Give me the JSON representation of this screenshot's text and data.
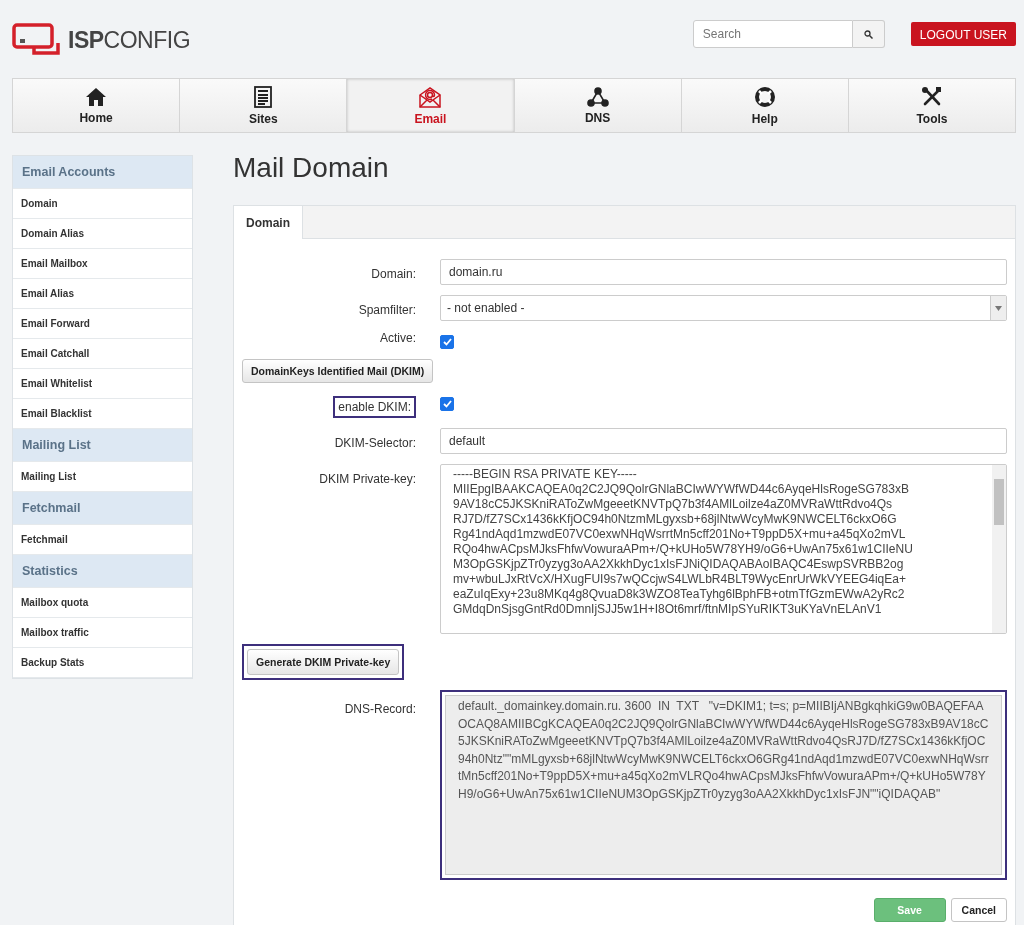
{
  "header": {
    "logo": "**ISP**CONFIG",
    "search": {
      "placeholder": "Search"
    },
    "logout": "LOGOUT USER"
  },
  "nav": [
    {
      "label": "Home",
      "selected": false
    },
    {
      "label": "Sites",
      "selected": false
    },
    {
      "label": "Email",
      "selected": true
    },
    {
      "label": "DNS",
      "selected": false
    },
    {
      "label": "Help",
      "selected": false
    },
    {
      "label": "Tools",
      "selected": false
    }
  ],
  "sidebar": [
    {
      "kind": "header",
      "label": "Email Accounts"
    },
    {
      "kind": "item",
      "label": "Domain"
    },
    {
      "kind": "item",
      "label": "Domain Alias"
    },
    {
      "kind": "item",
      "label": "Email Mailbox"
    },
    {
      "kind": "item",
      "label": "Email Alias"
    },
    {
      "kind": "item",
      "label": "Email Forward"
    },
    {
      "kind": "item",
      "label": "Email Catchall"
    },
    {
      "kind": "item",
      "label": "Email Whitelist"
    },
    {
      "kind": "item",
      "label": "Email Blacklist"
    },
    {
      "kind": "header",
      "label": "Mailing List"
    },
    {
      "kind": "item",
      "label": "Mailing List"
    },
    {
      "kind": "header",
      "label": "Fetchmail"
    },
    {
      "kind": "item",
      "label": "Fetchmail"
    },
    {
      "kind": "header",
      "label": "Statistics"
    },
    {
      "kind": "item",
      "label": "Mailbox quota"
    },
    {
      "kind": "item",
      "label": "Mailbox traffic"
    },
    {
      "kind": "item",
      "label": "Backup Stats"
    }
  ],
  "page_title": "Mail Domain",
  "tabs": [
    {
      "label": "Domain",
      "selected": true
    }
  ],
  "fields": [
    {
      "kind": "text",
      "label": "Domain:",
      "value": "domain.ru",
      "highlighted": false
    },
    {
      "kind": "select",
      "label": "Spamfilter:",
      "value": "- not enabled -",
      "highlighted": false
    },
    {
      "kind": "checkbox",
      "label": "Active:",
      "checked": true,
      "highlighted": false
    },
    {
      "kind": "button",
      "label": "DomainKeys Identified Mail (DKIM)",
      "highlighted": false
    },
    {
      "kind": "checkbox",
      "label": "enable DKIM:",
      "checked": true,
      "highlighted": true
    },
    {
      "kind": "text",
      "label": "DKIM-Selector:",
      "value": "default",
      "highlighted": false
    },
    {
      "kind": "textarea",
      "label": "DKIM Private-key:",
      "value": "-----BEGIN RSA PRIVATE KEY-----\nMIIEpgIBAAKCAQEA0q2C2JQ9QolrGNlaBCIwWYWfWD44c6AyqeHlsRogeSG783xB\n9AV18cC5JKSKniRAToZwMgeeetKNVTpQ7b3f4AMlLoilze4aZ0MVRaWttRdvo4Qs\nRJ7D/fZ7SCx1436kKfjOC94h0NtzmMLgyxsb+68jlNtwWcyMwK9NWCELT6ckxO6G\nRg41ndAqd1mzwdE07VC0exwNHqWsrrtMn5cff201No+T9ppD5X+mu+a45qXo2mVL\nRQo4hwACpsMJksFhfwVowuraAPm+/Q+kUHo5W78YH9/oG6+UwAn75x61w1CIIeNU\nM3OpGSKjpZTr0yzyg3oAA2XkkhDyc1xIsFJNiQIDAQABAoIBAQC4EswpSVRBB2og\nmv+wbuLJxRtVcX/HXugFUI9s7wQCcjwS4LWLbR4BLT9WycEnrUrWkVYEEG4iqEa+\neaZuIqExy+23u8MKq4g8QvuaD8k3WZO8TeaTyhg6lBphFB+otmTfGzmEWwA2yRc2\nGMdqDnSjsgGntRd0DmnIjSJJ5w1H+I8Ot6mrf/ftnMIpSYuRIKT3uKYaVnELAnV1",
      "highlighted": false
    },
    {
      "kind": "button",
      "label": "Generate DKIM Private-key",
      "highlighted": true
    },
    {
      "kind": "readonly",
      "label": "DNS-Record:",
      "value": "default._domainkey.domain.ru. 3600  IN  TXT   \"v=DKIM1; t=s; p=MIIBIjANBgkqhkiG9w0BAQEFAAOCAQ8AMIIBCgKCAQEA0q2C2JQ9QolrGNlaBCIwWYWfWD44c6AyqeHlsRogeSG783xB9AV18cC5JKSKniRAToZwMgeeetKNVTpQ7b3f4AMlLoilze4aZ0MVRaWttRdvo4QsRJ7D/fZ7SCx1436kKfjOC94h0Ntz\"\"mMLgyxsb+68jlNtwWcyMwK9NWCELT6ckxO6GRg41ndAqd1mzwdE07VC0exwNHqWsrrtMn5cff201No+T9ppD5X+mu+a45qXo2mVLRQo4hwACpsMJksFhfwVowuraAPm+/Q+kUHo5W78YH9/oG6+UwAn75x61w1CIIeNUM3OpGSKjpZTr0yzyg3oAA2XkkhDyc1xIsFJN\"\"iQIDAQAB\"",
      "highlighted": true
    }
  ],
  "actions": [
    {
      "kind": "primary",
      "label": "Save"
    },
    {
      "kind": "secondary",
      "label": "Cancel"
    }
  ]
}
